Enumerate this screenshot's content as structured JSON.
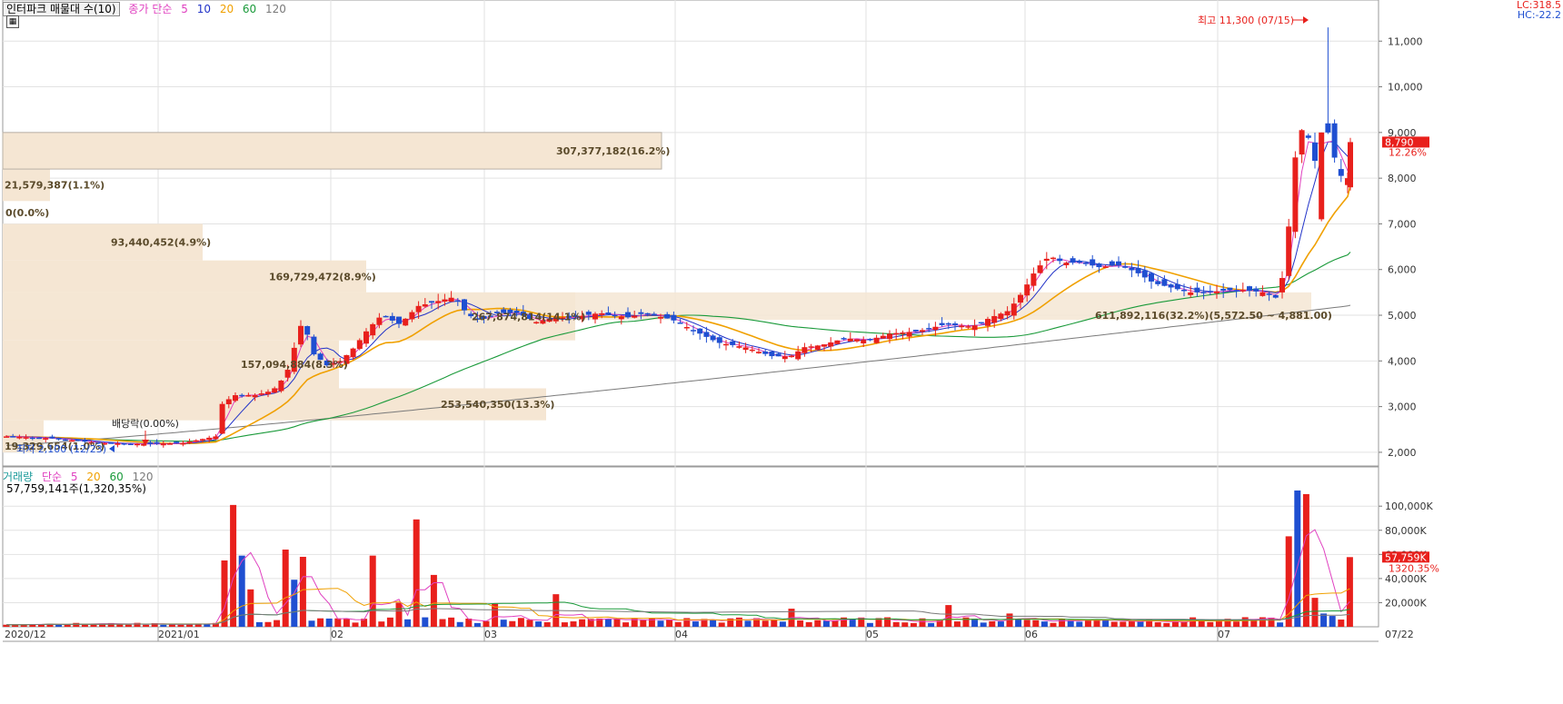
{
  "header": {
    "title_chip": "인터파크 매물대 수(10)",
    "ma_label": "종가 단순",
    "ma_periods": [
      "5",
      "10",
      "20",
      "60",
      "120"
    ],
    "corner_lc": "LC:318.5",
    "corner_hc": "HC:-22.2"
  },
  "volume_header": {
    "label": "거래량",
    "ma_label": "단순",
    "ma_periods": [
      "5",
      "20",
      "60",
      "120"
    ],
    "last_value": "57,759,141주(1,320,35%)"
  },
  "colors": {
    "up": "#e8201c",
    "down": "#1f4fd1",
    "ma5": "#e040c0",
    "ma10": "#2233c8",
    "ma20": "#f0a000",
    "ma60": "#1a9a3a",
    "ma120": "#7a7a7a",
    "volume_profile": "#f5e6d3",
    "grid": "#e2e2e2"
  },
  "chart_data": [
    {
      "type": "candlestick",
      "title": "",
      "xlabel": "",
      "ylabel": "",
      "ylim": [
        1700,
        11900
      ],
      "grid": true,
      "x_labels": [
        "2020/12",
        "2021/01",
        "02",
        "03",
        "04",
        "05",
        "06",
        "07",
        "07/22"
      ],
      "y_ticks": [
        2000,
        3000,
        4000,
        5000,
        6000,
        7000,
        8000,
        9000,
        10000,
        11000
      ],
      "y_tick_labels": [
        "2,000",
        "3,000",
        "4,000",
        "5,000",
        "6,000",
        "7,000",
        "8,000",
        "9,000",
        "10,000",
        "11,000"
      ],
      "last_price": {
        "label": "8,790",
        "change": "12.26%",
        "value": 8790
      },
      "annotations": {
        "high": {
          "text": "최고 11,300 (07/15)",
          "value": 11300
        },
        "low": {
          "text": "최저 2,100 (12/23)",
          "value": 2100
        },
        "dividend": {
          "text": "배당락(0.00%)"
        }
      },
      "volume_profile": [
        {
          "low": 2000,
          "high": 2350,
          "label": "19,329,654(1.0%)"
        },
        {
          "low": 2350,
          "high": 2700,
          "label": ""
        },
        {
          "low": 2700,
          "high": 3400,
          "label": "253,540,350(13.3%)"
        },
        {
          "low": 3400,
          "high": 4450,
          "label": "157,094,884(8.3%)"
        },
        {
          "low": 4450,
          "high": 5500,
          "label": "267,874,814(14.1%)"
        },
        {
          "low": 5500,
          "high": 6200,
          "label": "169,729,472(8.9%)"
        },
        {
          "low": 6200,
          "high": 7000,
          "label": "93,440,452(4.9%)"
        },
        {
          "low": 7000,
          "high": 7500,
          "label": "0(0.0%)"
        },
        {
          "low": 7500,
          "high": 8200,
          "label": "21,579,387(1.1%)"
        },
        {
          "low": 8200,
          "high": 9000,
          "label": "307,377,182(16.2%)"
        },
        {
          "low": 4900,
          "high": 5500,
          "label": "611,892,116(32.2%)(5,572.50 ~ 4,881.00)"
        }
      ],
      "ma_end_values": {
        "ma5": 8200,
        "ma10": 7700,
        "ma20": 6600,
        "ma60": 5750,
        "ma120": 5220
      }
    },
    {
      "type": "bar",
      "title": "거래량",
      "ylim": [
        0,
        125000
      ],
      "y_ticks": [
        20000,
        40000,
        60000,
        80000,
        100000
      ],
      "y_tick_labels": [
        "20,000K",
        "40,000K",
        "60,000K",
        "80,000K",
        "100,000K"
      ],
      "last_volume": {
        "label": "57,759K",
        "change": "1320.35%",
        "value": 57759
      },
      "notable_bars": [
        {
          "date": "2021/01 mid",
          "value": 55000
        },
        {
          "date": "2021/01 mid",
          "value": 101000
        },
        {
          "date": "2021/01 late",
          "value": 64000
        },
        {
          "date": "2021/02 early",
          "value": 103000
        },
        {
          "date": "2021/02 mid",
          "value": 89000
        },
        {
          "date": "2021/06 early",
          "value": 49000
        },
        {
          "date": "2021/07/14",
          "value": 75000
        },
        {
          "date": "2021/07/15",
          "value": 113000
        },
        {
          "date": "2021/07/16",
          "value": 110000
        },
        {
          "date": "2021/07/22",
          "value": 57759
        }
      ]
    }
  ]
}
